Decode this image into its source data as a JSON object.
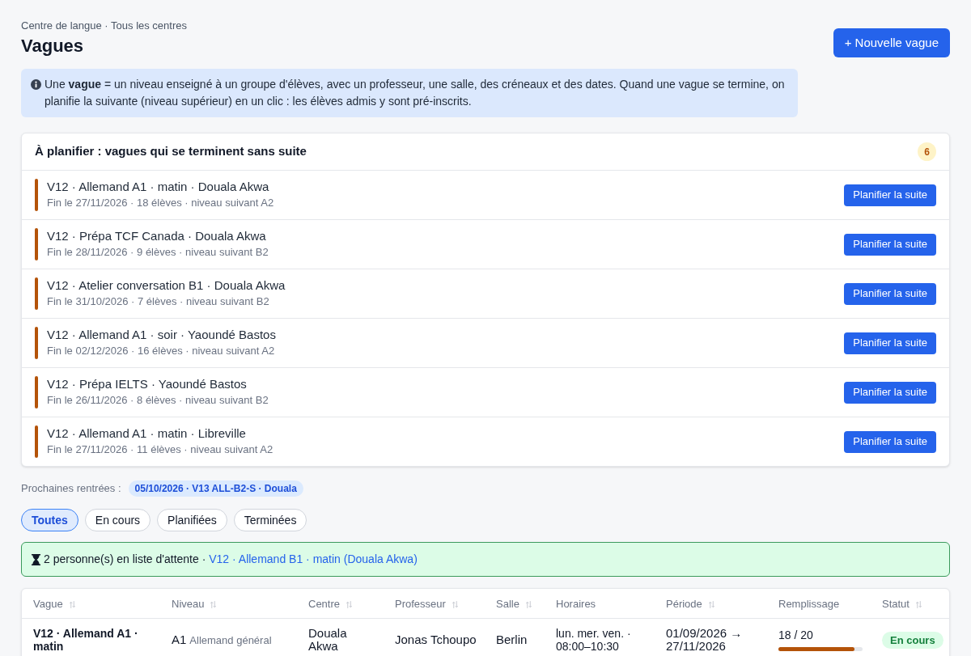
{
  "breadcrumb": "Centre de langue · Tous les centres",
  "title": "Vagues",
  "new_button": "+ Nouvelle vague",
  "info": "Une **vague** = un niveau enseigné à un groupe d'élèves, avec un professeur, une salle, des créneaux et des dates. Quand une vague se termine, on planifie la suivante (niveau supérieur) en un clic : les élèves admis y sont pré-inscrits.",
  "to_plan": {
    "title": "À planifier : vagues qui se terminent sans suite",
    "count": "6",
    "items": [
      {
        "title": "V12 · Allemand A1 · matin · Douala Akwa",
        "subtitle": "Fin le 27/11/2026 · 18 élèves · niveau suivant A2",
        "button": "Planifier la suite"
      },
      {
        "title": "V12 · Prépa TCF Canada · Douala Akwa",
        "subtitle": "Fin le 28/11/2026 · 9 élèves · niveau suivant B2",
        "button": "Planifier la suite"
      },
      {
        "title": "V12 · Atelier conversation B1 · Douala Akwa",
        "subtitle": "Fin le 31/10/2026 · 7 élèves · niveau suivant B2",
        "button": "Planifier la suite"
      },
      {
        "title": "V12 · Allemand A1 · soir · Yaoundé Bastos",
        "subtitle": "Fin le 02/12/2026 · 16 élèves · niveau suivant A2",
        "button": "Planifier la suite"
      },
      {
        "title": "V12 · Prépa IELTS · Yaoundé Bastos",
        "subtitle": "Fin le 26/11/2026 · 8 élèves · niveau suivant B2",
        "button": "Planifier la suite"
      },
      {
        "title": "V12 · Allemand A1 · matin · Libreville",
        "subtitle": "Fin le 27/11/2026 · 11 élèves · niveau suivant A2",
        "button": "Planifier la suite"
      }
    ]
  },
  "upcoming": {
    "label": "Prochaines rentrées :",
    "items": [
      "05/10/2026 · V13 ALL-B2-S · Douala"
    ]
  },
  "filters": [
    {
      "label": "Toutes",
      "selected": true
    },
    {
      "label": "En cours",
      "selected": false
    },
    {
      "label": "Planifiées",
      "selected": false
    },
    {
      "label": "Terminées",
      "selected": false
    }
  ],
  "waitlist": {
    "text": "2 personne(s) en liste d'attente ·",
    "link": "V12 · Allemand B1 · matin (Douala Akwa)"
  },
  "table": {
    "columns": [
      {
        "label": "Vague",
        "sortable": true
      },
      {
        "label": "Niveau",
        "sortable": true
      },
      {
        "label": "Centre",
        "sortable": true
      },
      {
        "label": "Professeur",
        "sortable": true
      },
      {
        "label": "Salle",
        "sortable": true
      },
      {
        "label": "Horaires",
        "sortable": false
      },
      {
        "label": "Période",
        "sortable": true
      },
      {
        "label": "Remplissage",
        "sortable": false
      },
      {
        "label": "Statut",
        "sortable": true
      }
    ],
    "rows": [
      {
        "wave": "V12 · Allemand A1 · matin",
        "niveau": "A1",
        "niveau_detail": "Allemand général",
        "centre": "Douala Akwa",
        "teacher": "Jonas Tchoupo",
        "room": "Berlin",
        "schedule": "lun. mer. ven. · 08:00–10:30",
        "period": "01/09/2026 → 27/11/2026",
        "filling": {
          "text": "18 / 20",
          "level": 0.9
        },
        "status": {
          "label": "En cours",
          "kind": "running"
        }
      }
    ]
  }
}
